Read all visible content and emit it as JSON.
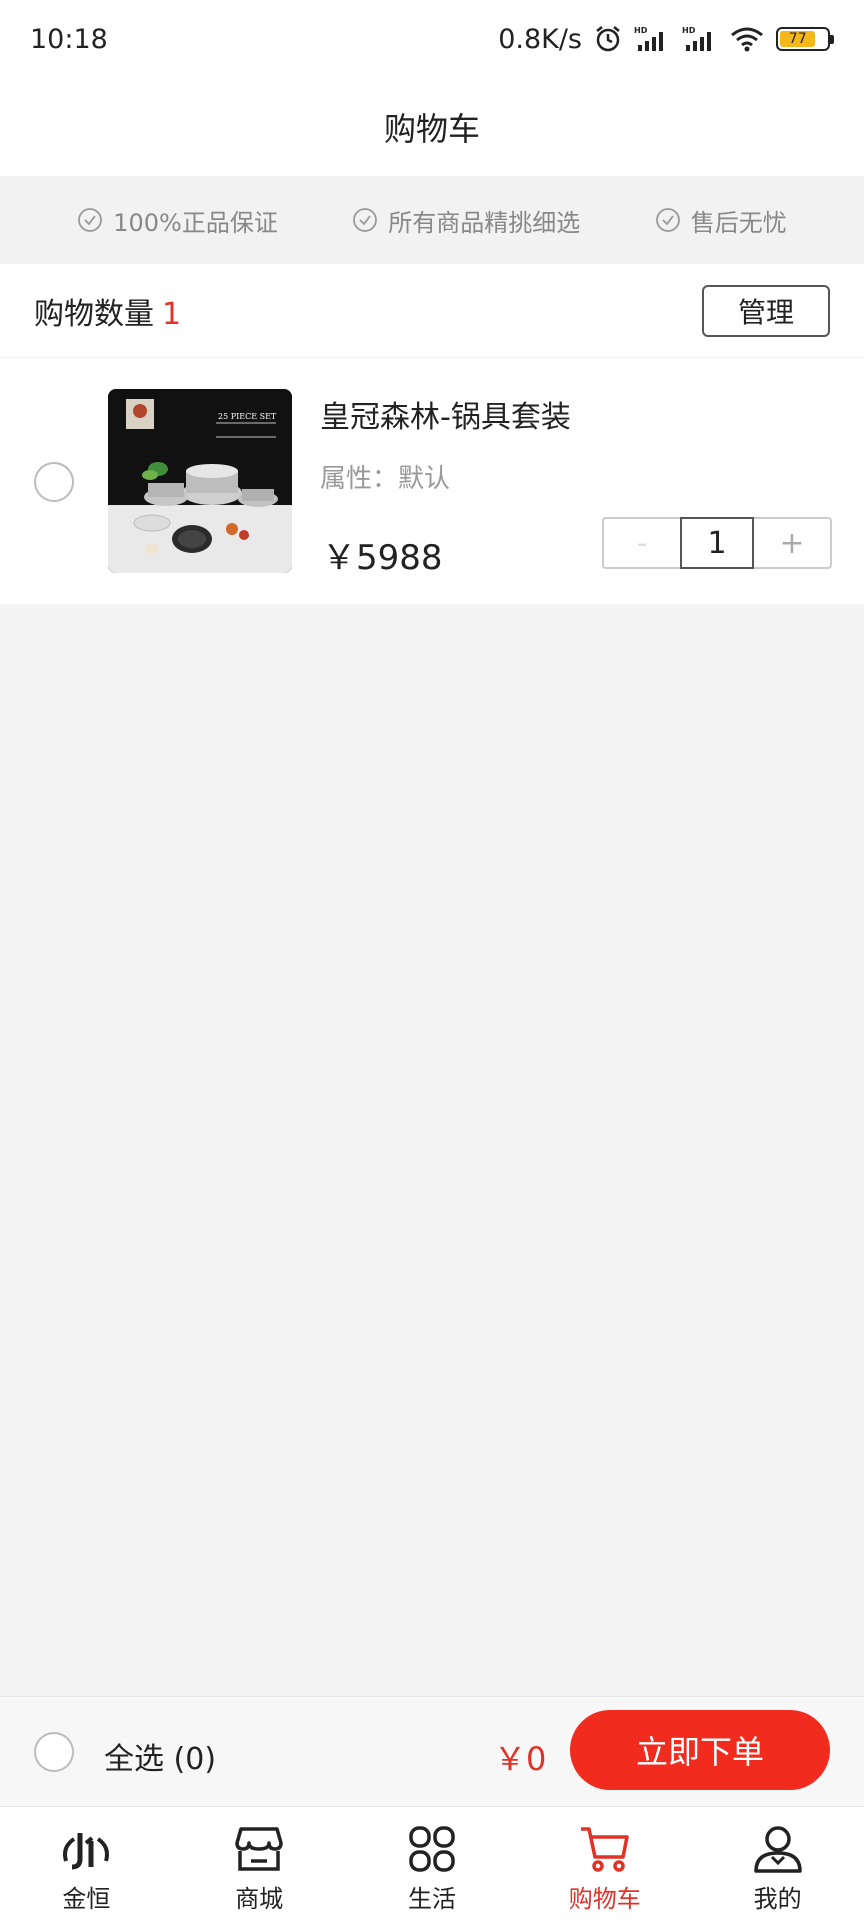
{
  "status_bar": {
    "time": "10:18",
    "net_speed": "0.8K/s",
    "battery": "77"
  },
  "header": {
    "title": "购物车"
  },
  "guarantees": [
    "100%正品保证",
    "所有商品精挑细选",
    "售后无忧"
  ],
  "cart": {
    "count_label": "购物数量",
    "count": "1",
    "manage_label": "管理",
    "items": [
      {
        "name": "皇冠森林-锅具套装",
        "attribute": "属性：默认",
        "price": "￥5988",
        "quantity": "1",
        "image_text": "25 PIECE SET"
      }
    ]
  },
  "action_bar": {
    "select_all": "全选 (0)",
    "total": "￥0",
    "order_button": "立即下单"
  },
  "tabs": [
    {
      "label": "金恒",
      "icon": "jinheng-logo-icon"
    },
    {
      "label": "商城",
      "icon": "store-icon"
    },
    {
      "label": "生活",
      "icon": "grid-icon"
    },
    {
      "label": "购物车",
      "icon": "cart-icon"
    },
    {
      "label": "我的",
      "icon": "person-icon"
    }
  ],
  "colors": {
    "accent": "#e03227",
    "button": "#f22b1f",
    "background": "#f4f4f4"
  }
}
